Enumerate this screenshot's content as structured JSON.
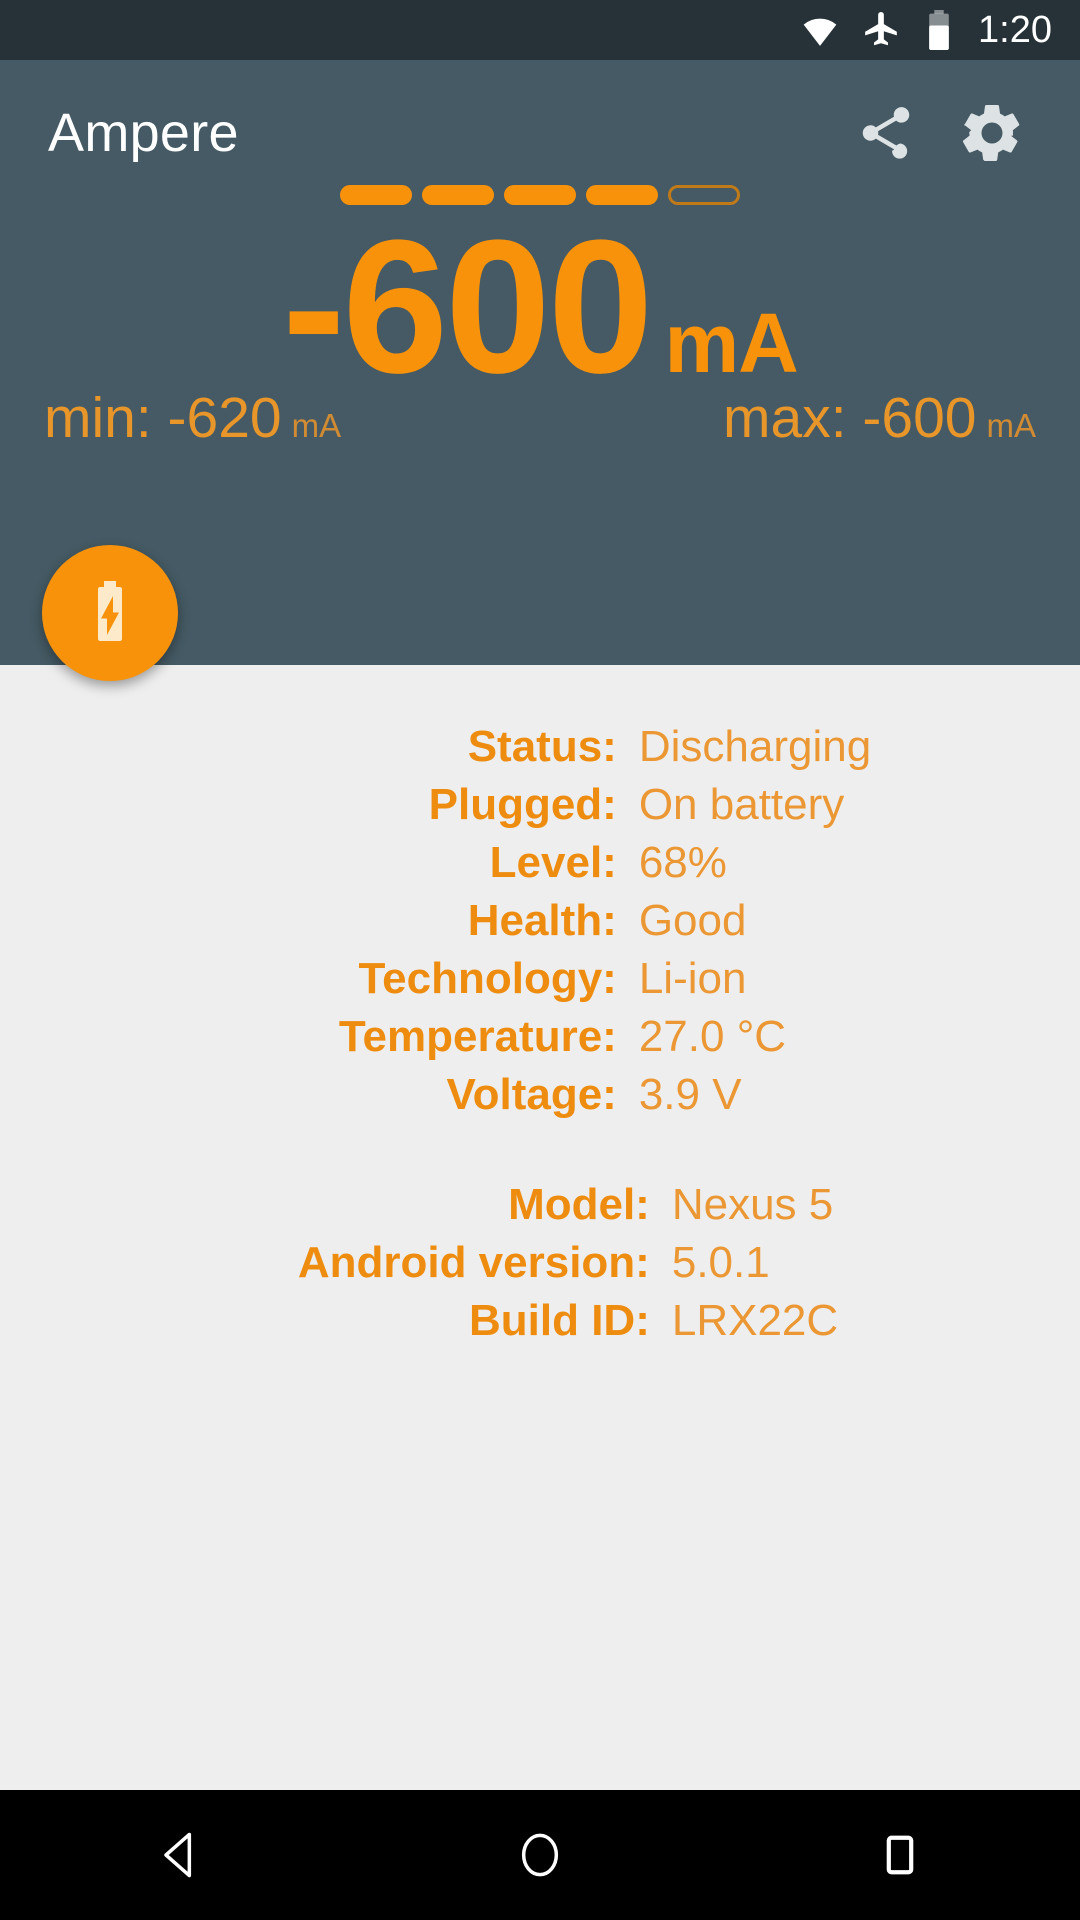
{
  "status_bar": {
    "time": "1:20",
    "icons": [
      "wifi-icon",
      "airplane-mode-icon",
      "battery-icon"
    ]
  },
  "app_bar": {
    "title": "Ampere",
    "share_label": "Share",
    "settings_label": "Settings"
  },
  "reading": {
    "value": "-600",
    "unit": "mA",
    "min_label": "min: -620",
    "min_unit": "mA",
    "max_label": "max: -600",
    "max_unit": "mA",
    "level_pills": {
      "total": 5,
      "filled": 4
    }
  },
  "fab": {
    "icon": "battery-charging-icon"
  },
  "battery_info": {
    "rows": [
      {
        "label": "Status:",
        "value": "Discharging"
      },
      {
        "label": "Plugged:",
        "value": "On battery"
      },
      {
        "label": "Level:",
        "value": "68%"
      },
      {
        "label": "Health:",
        "value": "Good"
      },
      {
        "label": "Technology:",
        "value": "Li-ion"
      },
      {
        "label": "Temperature:",
        "value": "27.0 °C"
      },
      {
        "label": "Voltage:",
        "value": "3.9 V"
      }
    ]
  },
  "device_info": {
    "rows": [
      {
        "label": "Model:",
        "value": "Nexus 5"
      },
      {
        "label": "Android version:",
        "value": "5.0.1"
      },
      {
        "label": "Build ID:",
        "value": "LRX22C"
      }
    ]
  },
  "nav_bar": {
    "back_label": "Back",
    "home_label": "Home",
    "recents_label": "Recent apps"
  },
  "colors": {
    "header_bg": "#455A64",
    "status_bar_bg": "#263238",
    "body_bg": "#EEEEEE",
    "accent_orange": "#F8920B",
    "value_orange": "#EB9734",
    "label_orange": "#EE8C10",
    "nav_bg": "#000000"
  }
}
